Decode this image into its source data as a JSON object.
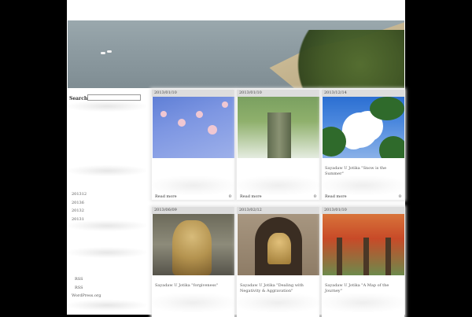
{
  "search": {
    "label": "Search",
    "placeholder": ""
  },
  "archives": [
    "201312",
    "20136",
    "20132",
    "20131"
  ],
  "meta_links": [
    "RSS",
    "RSS",
    "WordPress.org"
  ],
  "posts": [
    {
      "date": "2013/01/10",
      "title": "",
      "readmore": "Read more",
      "count": "0",
      "thumb": "plum-blossom-photo"
    },
    {
      "date": "2013/01/10",
      "title": "",
      "readmore": "Read more",
      "count": "0",
      "thumb": "banyan-tree-photo"
    },
    {
      "date": "2013/12/14",
      "title": "Sayadaw U Jotika \"Snow is the Summer\"",
      "readmore": "Read more",
      "count": "0",
      "thumb": "cloud-tree-photo"
    },
    {
      "date": "2013/06/09",
      "title": "Sayadaw U Jotika \"forgiveness\"",
      "readmore": "",
      "count": "",
      "thumb": "buddha-statue-photo"
    },
    {
      "date": "2013/02/12",
      "title": "Sayadaw U Jotika \"Dealing with Negativity & Aggravation\"",
      "readmore": "",
      "count": "",
      "thumb": "buddha-niche-photo"
    },
    {
      "date": "2013/01/10",
      "title": "Sayadaw U Jotika \"A Map of the Journey\"",
      "readmore": "",
      "count": "",
      "thumb": "autumn-forest-photo"
    }
  ]
}
